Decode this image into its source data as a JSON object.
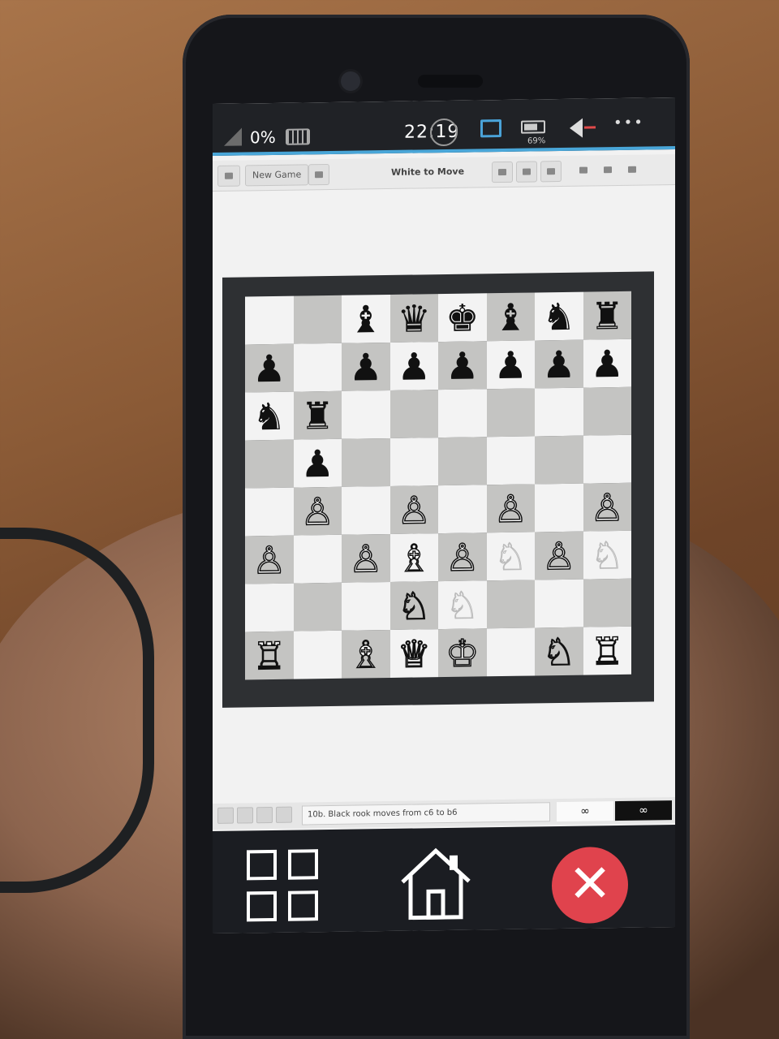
{
  "status_bar": {
    "signal_percent": "0%",
    "time": "22:19",
    "battery_percent": "69%",
    "more_icon": "•••"
  },
  "toolbar": {
    "new_game_label": "New Game",
    "title": "White to Move"
  },
  "board": {
    "squares": [
      [
        "",
        "",
        "♝",
        "♛",
        "♚",
        "♝",
        "♞",
        "♜"
      ],
      [
        "♟",
        "",
        "♟",
        "♟",
        "♟",
        "♟",
        "♟",
        "♟"
      ],
      [
        "♞",
        "♜",
        "",
        "",
        "",
        "",
        "",
        ""
      ],
      [
        "",
        "♟",
        "",
        "",
        "",
        "",
        "",
        ""
      ],
      [
        "",
        "♙",
        "",
        "♙",
        "",
        "♙",
        "",
        "♙"
      ],
      [
        "♙",
        "",
        "♙",
        "♗",
        "♙",
        "♘",
        "♙",
        "♘"
      ],
      [
        "",
        "",
        "",
        "♘",
        "♘",
        "",
        "",
        ""
      ],
      [
        "♖",
        "",
        "♗",
        "♕",
        "♔",
        "",
        "♘",
        "♖"
      ]
    ],
    "colors": [
      [
        "",
        "",
        "b",
        "b",
        "b",
        "b",
        "b",
        "b"
      ],
      [
        "b",
        "",
        "b",
        "b",
        "b",
        "b",
        "b",
        "b"
      ],
      [
        "b",
        "b",
        "",
        "",
        "",
        "",
        "",
        ""
      ],
      [
        "",
        "b",
        "",
        "",
        "",
        "",
        "",
        ""
      ],
      [
        "",
        "w",
        "",
        "w",
        "",
        "w",
        "",
        "w"
      ],
      [
        "w",
        "",
        "w",
        "w",
        "w",
        "g",
        "w",
        "g"
      ],
      [
        "",
        "",
        "",
        "w",
        "g",
        "",
        "",
        ""
      ],
      [
        "w",
        "",
        "w",
        "w",
        "w",
        "",
        "w",
        "w"
      ]
    ]
  },
  "move_bar": {
    "last_move": "10b. Black rook moves from c6 to b6",
    "white_clock": "∞",
    "black_clock": "∞"
  },
  "nav": {
    "close_glyph": "✕"
  },
  "colors": {
    "accent": "#49a6d8",
    "close_button": "#e0434d",
    "board_frame": "#2e3033",
    "dark_square": "#c4c4c2",
    "light_square": "#f3f3f3"
  }
}
